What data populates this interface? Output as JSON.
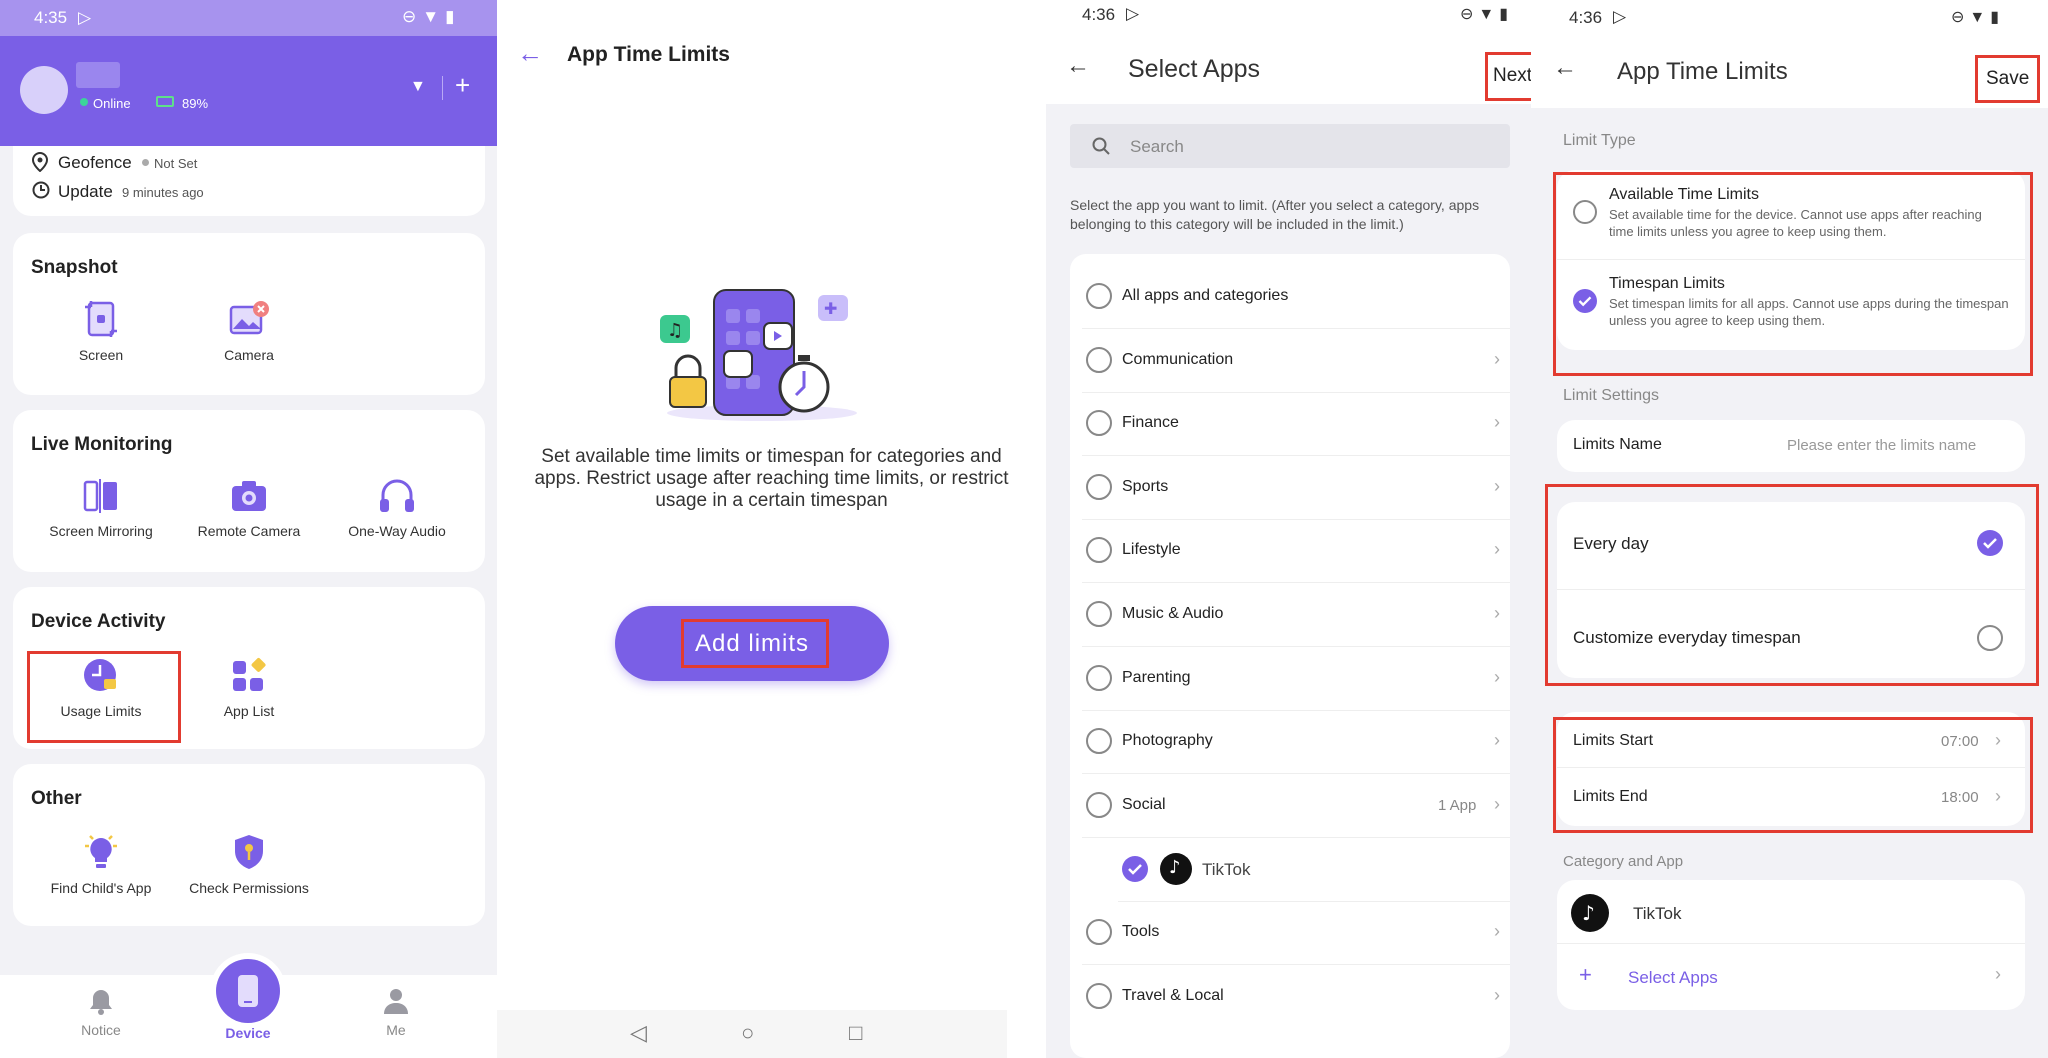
{
  "screen1": {
    "status_time": "4:35",
    "header": {
      "online": "Online",
      "battery": "89%"
    },
    "geofence": {
      "label": "Geofence",
      "status": "Not Set"
    },
    "update": {
      "label": "Update",
      "time": "9 minutes ago"
    },
    "snapshot": {
      "title": "Snapshot",
      "screen": "Screen",
      "camera": "Camera"
    },
    "live": {
      "title": "Live Monitoring",
      "mirroring": "Screen Mirroring",
      "remote_camera": "Remote Camera",
      "audio": "One-Way Audio"
    },
    "activity": {
      "title": "Device Activity",
      "usage": "Usage Limits",
      "app_list": "App List"
    },
    "other": {
      "title": "Other",
      "find": "Find Child's App",
      "permissions": "Check Permissions"
    },
    "tabs": {
      "notice": "Notice",
      "device": "Device",
      "me": "Me"
    },
    "accent": "#7a5fe6"
  },
  "screen2": {
    "title": "App Time Limits",
    "description": "Set available time limits or timespan for categories and apps. Restrict usage after reaching time limits, or restrict usage in a certain timespan",
    "button": "Add limits"
  },
  "screen3": {
    "status_time": "4:36",
    "title": "Select Apps",
    "next": "Next",
    "search_placeholder": "Search",
    "hint": "Select the app you want to limit. (After you select a category, apps belonging to this category will be included in the limit.)",
    "items": [
      "All apps and categories",
      "Communication",
      "Finance",
      "Sports",
      "Lifestyle",
      "Music & Audio",
      "Parenting",
      "Photography",
      "Social",
      "TikTok",
      "Tools",
      "Travel & Local"
    ],
    "social_count": "1 App"
  },
  "screen4": {
    "status_time": "4:36",
    "title": "App Time Limits",
    "save": "Save",
    "limit_type": "Limit Type",
    "available": {
      "title": "Available Time Limits",
      "desc": "Set available time for the device. Cannot use apps after reaching time limits unless you agree to keep using them."
    },
    "timespan": {
      "title": "Timespan Limits",
      "desc": "Set timespan limits for all apps. Cannot use apps during the timespan unless you agree to keep using them."
    },
    "limit_settings": "Limit Settings",
    "limits_name": {
      "label": "Limits Name",
      "placeholder": "Please enter the limits name"
    },
    "every_day": "Every day",
    "customize": "Customize everyday timespan",
    "start": {
      "label": "Limits Start",
      "value": "07:00"
    },
    "end": {
      "label": "Limits End",
      "value": "18:00"
    },
    "category_and_app": "Category and App",
    "app": "TikTok",
    "select_apps": "Select Apps"
  }
}
